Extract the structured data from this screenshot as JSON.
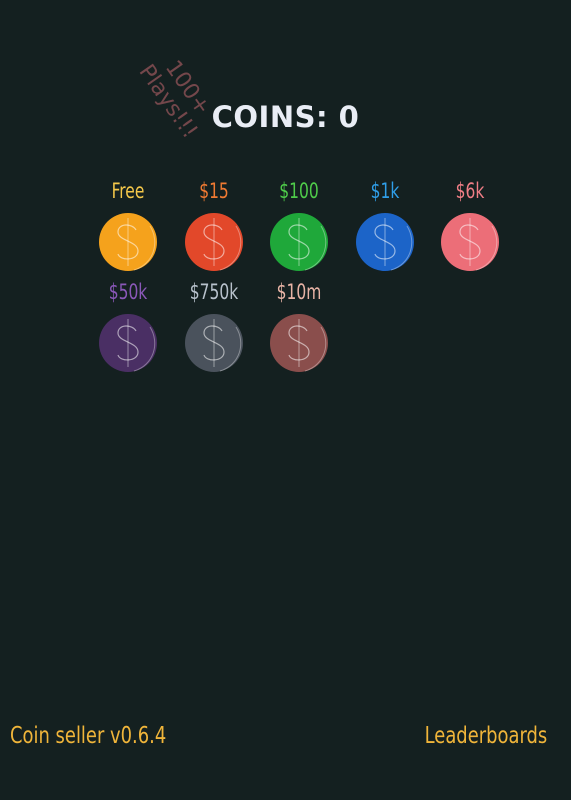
{
  "banner": {
    "line1": "100+",
    "line2": "Plays!!!",
    "color": "#7a4a4e"
  },
  "coins_label": "COINS: 0",
  "coins": [
    {
      "price": "Free",
      "color": "#f5a21c",
      "price_color": "#f5c84a",
      "icon": "dollar-coin-icon"
    },
    {
      "price": "$15",
      "color": "#e2482a",
      "price_color": "#f07a32",
      "icon": "dollar-coin-icon"
    },
    {
      "price": "$100",
      "color": "#1fa83a",
      "price_color": "#4fcc4a",
      "icon": "dollar-coin-icon"
    },
    {
      "price": "$1k",
      "color": "#1c64c8",
      "price_color": "#2f9ee8",
      "icon": "dollar-coin-icon"
    },
    {
      "price": "$6k",
      "color": "#ec6e78",
      "price_color": "#f07e86",
      "icon": "dollar-coin-icon"
    },
    {
      "price": "$50k",
      "color": "#4a2f64",
      "price_color": "#8a58b8",
      "icon": "dollar-coin-icon"
    },
    {
      "price": "$750k",
      "color": "#4a525c",
      "price_color": "#b8c2cc",
      "icon": "dollar-coin-icon"
    },
    {
      "price": "$10m",
      "color": "#8a4e4c",
      "price_color": "#e8b4a6",
      "icon": "dollar-coin-icon"
    }
  ],
  "footer": {
    "version": "Coin seller v0.6.4",
    "leaderboards": "Leaderboards",
    "color": "#f0b53a"
  },
  "background": "#142020"
}
